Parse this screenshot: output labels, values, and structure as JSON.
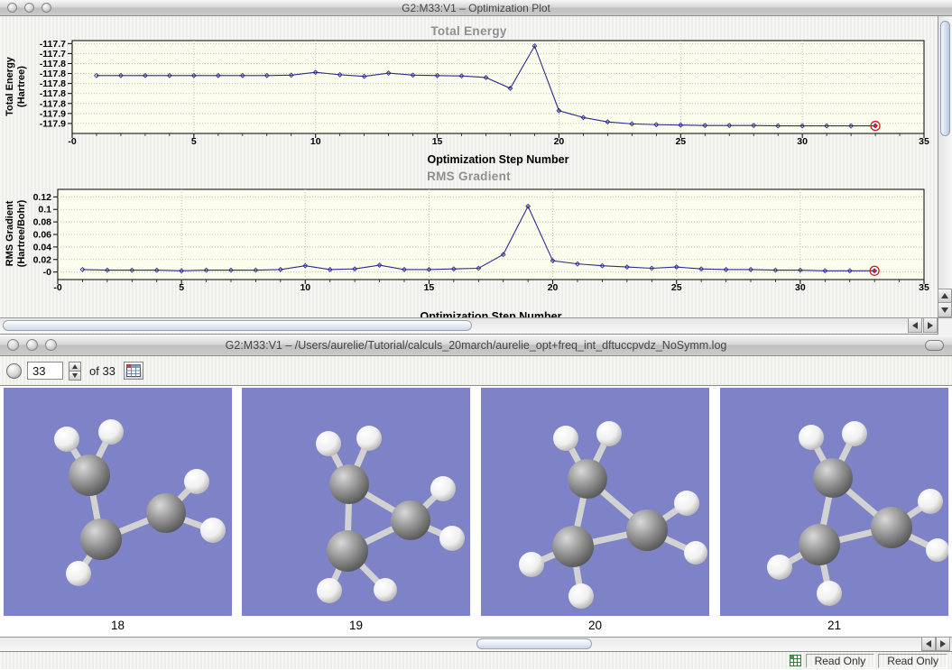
{
  "plot_window": {
    "title": "G2:M33:V1 – Optimization Plot"
  },
  "viewer_window": {
    "title": "G2:M33:V1 – /Users/aurelie/Tutorial/calculs_20march/aurelie_opt+freq_int_dftuccpvdz_NoSymm.log",
    "toolbar": {
      "frame_number": "33",
      "of_total": "of 33"
    },
    "frame_labels": [
      "18",
      "19",
      "20",
      "21"
    ],
    "status_fields": [
      "Read Only",
      "Read Only"
    ]
  },
  "colors": {
    "line": "#2a2a90",
    "last_point_ring": "#cc2222",
    "plot_background": "#fdfdee",
    "molecule_background": "#7e82c6"
  },
  "chart_data": [
    {
      "type": "line",
      "title": "Total Energy",
      "ylabel_lines": [
        "Total Energy",
        "(Hartree)"
      ],
      "xlabel": "Optimization Step Number",
      "x": [
        1,
        2,
        3,
        4,
        5,
        6,
        7,
        8,
        9,
        10,
        11,
        12,
        13,
        14,
        15,
        16,
        17,
        18,
        19,
        20,
        21,
        22,
        23,
        24,
        25,
        26,
        27,
        28,
        29,
        30,
        31,
        32,
        33
      ],
      "values": [
        -117.78,
        -117.78,
        -117.78,
        -117.78,
        -117.78,
        -117.78,
        -117.78,
        -117.78,
        -117.779,
        -117.772,
        -117.778,
        -117.782,
        -117.774,
        -117.779,
        -117.78,
        -117.781,
        -117.785,
        -117.812,
        -117.706,
        -117.868,
        -117.885,
        -117.896,
        -117.901,
        -117.903,
        -117.904,
        -117.905,
        -117.905,
        -117.905,
        -117.906,
        -117.906,
        -117.906,
        -117.906,
        -117.906
      ],
      "xlim": [
        0,
        35
      ],
      "ylim": [
        -117.925,
        -117.6925
      ],
      "x_tick_values": [
        0,
        5,
        10,
        15,
        20,
        25,
        30,
        35
      ],
      "x_tick_labels": [
        "-0",
        "5",
        "10",
        "15",
        "20",
        "25",
        "30",
        "35"
      ],
      "y_tick_values": [
        -117.7,
        -117.725,
        -117.75,
        -117.775,
        -117.8,
        -117.825,
        -117.85,
        -117.875,
        -117.9
      ],
      "y_tick_labels": [
        "-117.7",
        "-117.7",
        "-117.8",
        "-117.8",
        "-117.8",
        "-117.8",
        "-117.8",
        "-117.9",
        "-117.9"
      ],
      "grid": true,
      "legend": "none",
      "line_color": "#2a2a90",
      "ring_color": "#cc2222",
      "plot_bg": "#fdfdee"
    },
    {
      "type": "line",
      "title": "RMS Gradient",
      "ylabel_lines": [
        "RMS Gradient",
        "(Hartree/Bohr)"
      ],
      "xlabel": "Optimization Step Number",
      "x": [
        1,
        2,
        3,
        4,
        5,
        6,
        7,
        8,
        9,
        10,
        11,
        12,
        13,
        14,
        15,
        16,
        17,
        18,
        19,
        20,
        21,
        22,
        23,
        24,
        25,
        26,
        27,
        28,
        29,
        30,
        31,
        32,
        33
      ],
      "values": [
        0.004,
        0.003,
        0.003,
        0.003,
        0.002,
        0.003,
        0.003,
        0.003,
        0.004,
        0.01,
        0.004,
        0.005,
        0.011,
        0.004,
        0.004,
        0.005,
        0.006,
        0.028,
        0.105,
        0.018,
        0.013,
        0.01,
        0.008,
        0.006,
        0.008,
        0.005,
        0.004,
        0.004,
        0.003,
        0.003,
        0.002,
        0.002,
        0.002
      ],
      "xlim": [
        0,
        35
      ],
      "ylim": [
        -0.012,
        0.132
      ],
      "x_tick_values": [
        0,
        5,
        10,
        15,
        20,
        25,
        30,
        35
      ],
      "x_tick_labels": [
        "-0",
        "5",
        "10",
        "15",
        "20",
        "25",
        "30",
        "35"
      ],
      "y_tick_values": [
        0.12,
        0.1,
        0.08,
        0.06,
        0.04,
        0.02,
        0.0
      ],
      "y_tick_labels": [
        "0.12",
        "0.1",
        "0.08",
        "0.06",
        "0.04",
        "0.02",
        "-0"
      ],
      "grid": true,
      "legend": "none",
      "line_color": "#2a2a90",
      "ring_color": "#cc2222",
      "plot_bg": "#fdfdee"
    }
  ]
}
